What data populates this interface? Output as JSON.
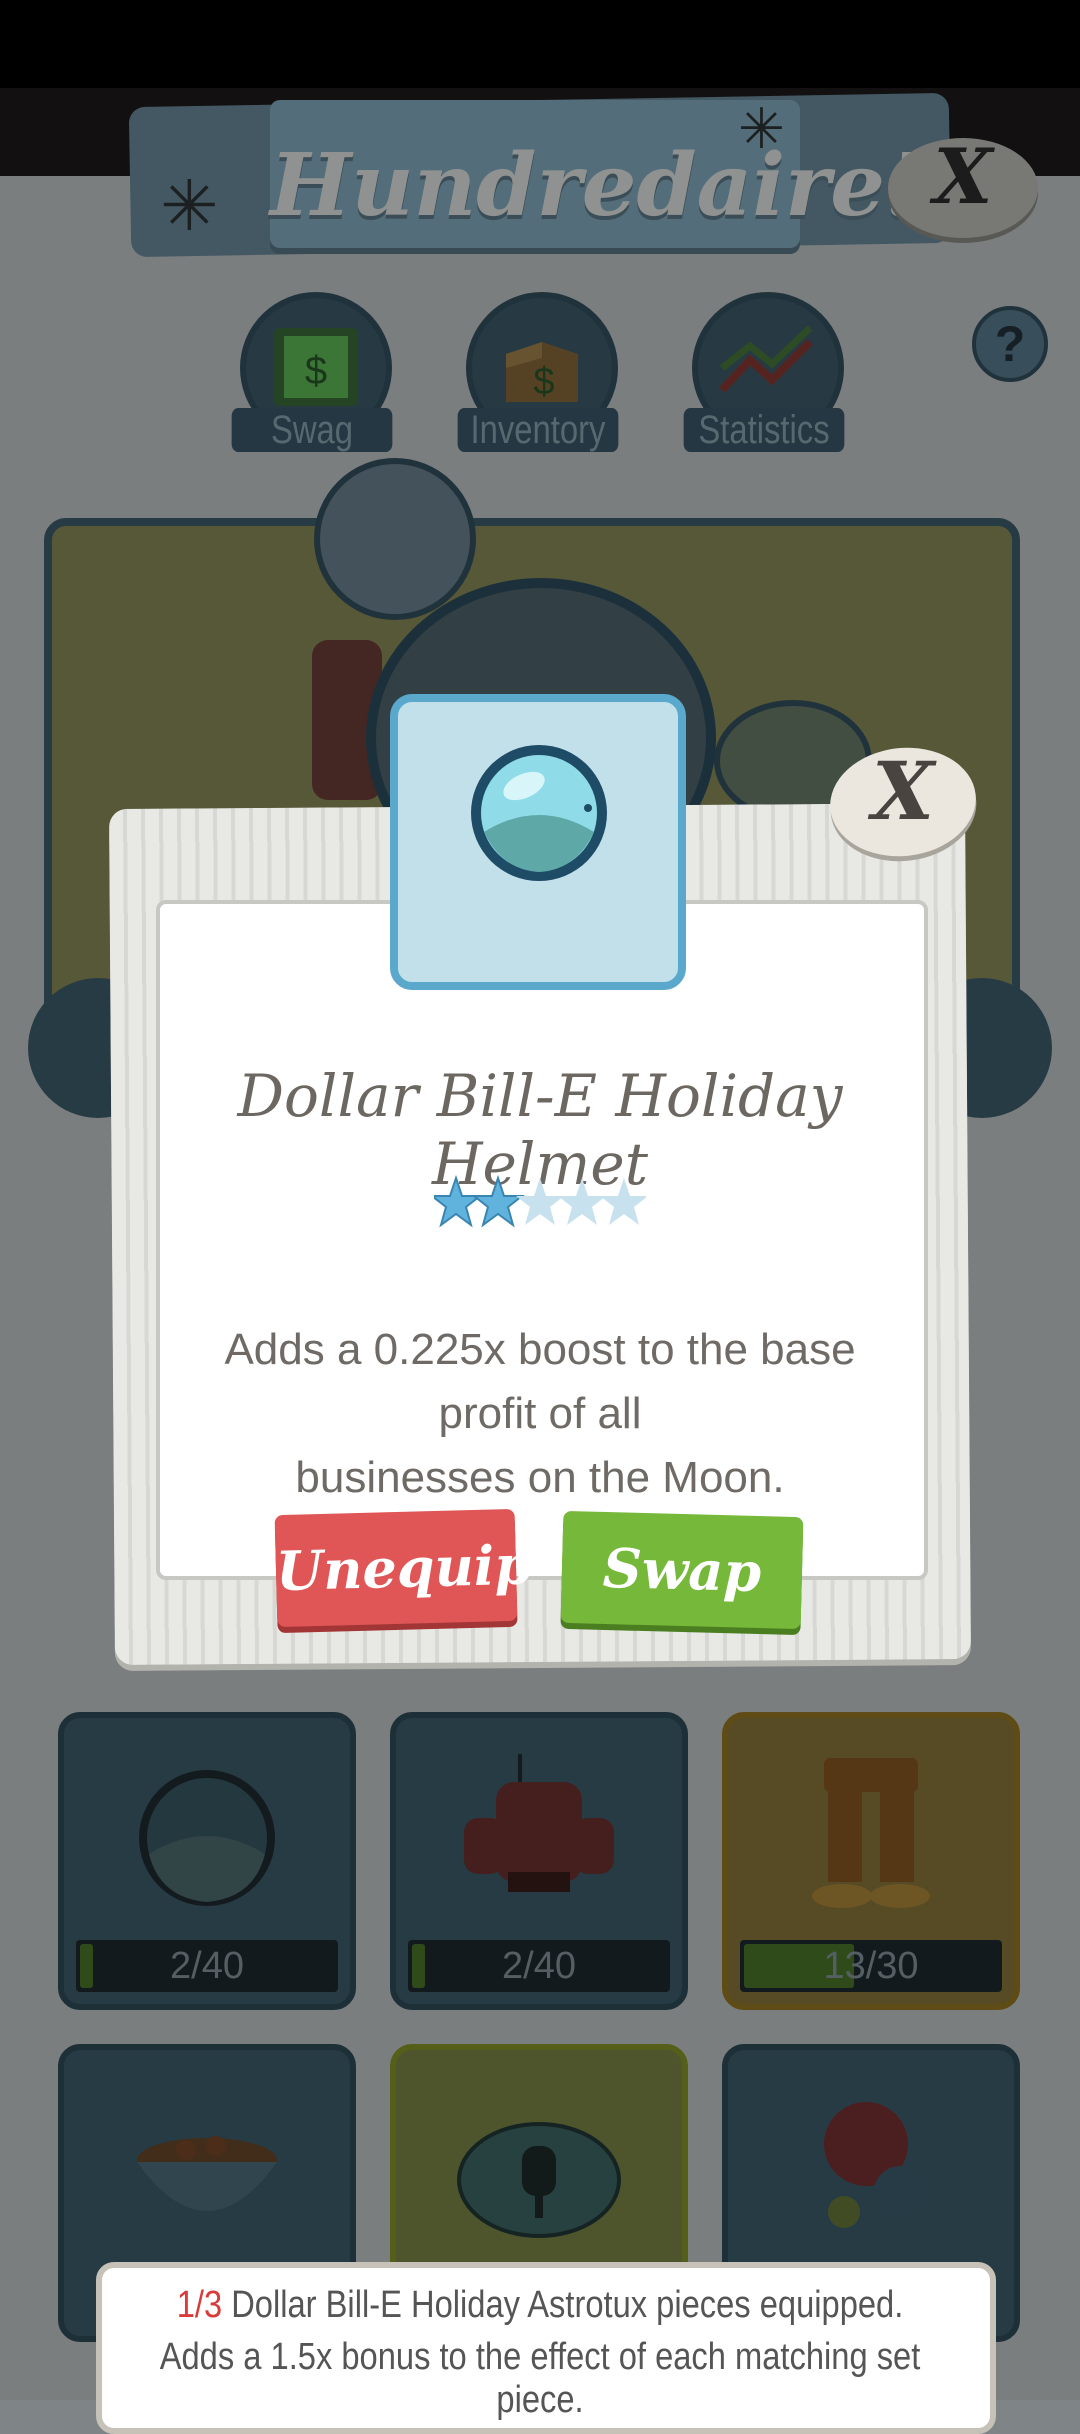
{
  "title": "Hundredaire!",
  "nav": {
    "tabs": [
      {
        "label": "Swag",
        "icon": "money-bills-icon"
      },
      {
        "label": "Inventory",
        "icon": "money-box-icon"
      },
      {
        "label": "Statistics",
        "icon": "trend-arrows-icon"
      }
    ],
    "help_label": "?"
  },
  "close_label": "X",
  "cards": [
    {
      "progress": "2/40",
      "icon": "helmet-icon",
      "fill": 0.05
    },
    {
      "progress": "2/40",
      "icon": "robot-suit-icon",
      "fill": 0.05
    },
    {
      "progress": "13/30",
      "icon": "space-boots-icon",
      "fill": 0.43
    },
    {
      "progress": "",
      "icon": "cereal-bowl-icon",
      "fill": 0.0
    },
    {
      "progress": "",
      "icon": "popsicle-icon",
      "fill": 0.0
    },
    {
      "progress": "",
      "icon": "stop-badge-icon",
      "fill": 0.0
    }
  ],
  "modal": {
    "item_name": "Dollar Bill-E Holiday Helmet",
    "rating": 2,
    "rating_max": 5,
    "description_1": "Adds a 0.225x boost to the base profit of all",
    "description_2": "businesses on the Moon.",
    "unequip_label": "Unequip",
    "swap_label": "Swap"
  },
  "set_info": {
    "count": "1/3",
    "line_1_rest": " Dollar Bill-E Holiday Astrotux pieces equipped.",
    "line_2": "Adds a 1.5x bonus to the effect of each matching set piece."
  },
  "colors": {
    "accent_blue": "#5aa8cc",
    "unequip_red": "#e05555",
    "swap_green": "#76b83a",
    "star_filled": "#5fb3dd",
    "star_empty": "#c7e2ee"
  }
}
